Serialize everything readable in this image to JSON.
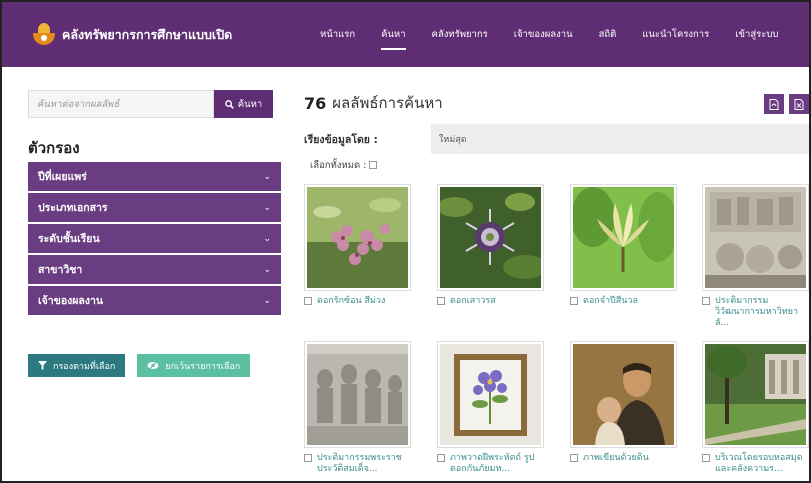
{
  "header": {
    "brand": "คลังทรัพยากรการศึกษาแบบเปิด",
    "nav": [
      "หน้าแรก",
      "ค้นหา",
      "คลังทรัพยากร",
      "เจ้าของผลงาน",
      "สถิติ",
      "แนะนำโครงการ",
      "เข้าสู่ระบบ"
    ],
    "active_index": 1
  },
  "sidebar": {
    "search_placeholder": "ค้นหาต่อจากผลลัพธ์",
    "search_button": "ค้นหา",
    "filter_title": "ตัวกรอง",
    "filters": [
      "ปีที่เผยแพร่",
      "ประเภทเอกสาร",
      "ระดับชั้นเรียน",
      "สาขาวิชา",
      "เจ้าของผลงาน"
    ],
    "apply_button": "กรองตามที่เลือก",
    "cancel_button": "ยกเว้นรายการเลือก"
  },
  "results": {
    "count": "76",
    "label": "ผลลัพธ์การค้นหา",
    "sort_label": "เรียงข้อมูลโดย :",
    "sort_value": "ใหม่สุด",
    "select_all": "เลือกทั้งหมด :",
    "items": [
      {
        "caption": "ดอกรักซ้อน สีม่วง",
        "thumb": "pink-flowers-thumbnail"
      },
      {
        "caption": "ดอกเสาวรส",
        "thumb": "passion-flower-thumbnail"
      },
      {
        "caption": "ดอกจำปีสีนวล",
        "thumb": "champak-flower-thumbnail"
      },
      {
        "caption": "ประติมากรรม วิวัฒนาการมหาวิทยาลั...",
        "thumb": "relief-sculpture-thumbnail"
      },
      {
        "caption": "ประติมากรรมพระราชประวัติสมเด็จ...",
        "thumb": "royal-relief-thumbnail"
      },
      {
        "caption": "ภาพวาดฝีพระหัตถ์ รูปดอกกันภัยมห...",
        "thumb": "royal-painting-thumbnail"
      },
      {
        "caption": "ภาพเขียนด้วยดิน",
        "thumb": "portrait-painting-thumbnail"
      },
      {
        "caption": "บริเวณโดยรอบหอสมุดและคลังความร...",
        "thumb": "campus-grounds-thumbnail"
      }
    ]
  },
  "colors": {
    "header_bg": "#5f2d73",
    "filter_bg": "#6a3d82",
    "apply_bg": "#2c7a80",
    "cancel_bg": "#5bbfa2",
    "caption_text": "#3b8f8f"
  }
}
